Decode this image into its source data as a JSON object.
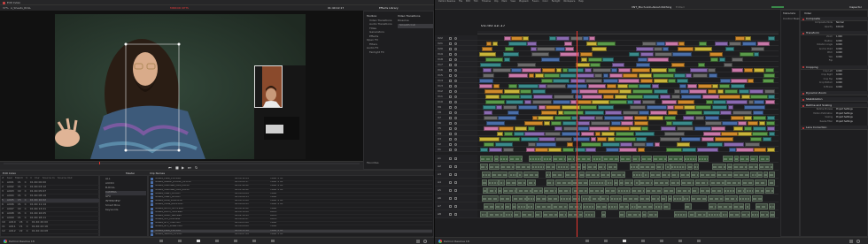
{
  "left_monitor": {
    "window_title": "Edit Index",
    "menu_items": [
      "File",
      "Edit",
      "Trim",
      "Timeline",
      "Clip",
      "Mark",
      "View",
      "Playback",
      "Fusion",
      "Color",
      "Fairlight",
      "Workspace",
      "Help"
    ],
    "viewer_title": "MIRROR OPTS",
    "viewer_zoom": "37%",
    "clip_name": "A_Sheets_ROLL",
    "timecode": "01:40:12:17",
    "effects_tab": "Effects Library",
    "toolbox": [
      "Toolbox",
      "Video Transitions",
      "Audio Transitions",
      "Titles",
      "Generators",
      "Effects",
      "Open FX",
      "Filters",
      "Audio FX",
      "Fairlight FX"
    ],
    "video_transitions_header": "Video Transitions",
    "transition_items": [
      "Dissolve",
      "Smooth Cut"
    ],
    "favorites": "Favorites",
    "edit_index_title": "Edit Index",
    "edit_index_columns": [
      "#",
      "Reel",
      "Match",
      "V",
      "C",
      "Dur",
      "Source In",
      "Source Out",
      "Record In",
      "Record Out",
      "Name"
    ],
    "edit_index_rows": [
      [
        "1",
        "A001",
        "V1",
        "C",
        "01:40:00:00"
      ],
      [
        "2",
        "A002",
        "V1",
        "C",
        "01:40:03:12"
      ],
      [
        "3",
        "A003",
        "V2",
        "C",
        "01:40:05:07"
      ],
      [
        "4",
        "A004",
        "V1",
        "C",
        "01:40:08:19"
      ],
      [
        "5",
        "A005",
        "V3",
        "C",
        "01:40:10:02"
      ],
      [
        "6",
        "A006",
        "V1",
        "C",
        "01:40:11:14"
      ],
      [
        "7",
        "A007",
        "V2",
        "C",
        "01:40:13:21"
      ],
      [
        "8",
        "A008",
        "V1",
        "C",
        "01:40:16:05"
      ],
      [
        "9",
        "A009",
        "V1",
        "C",
        "01:40:18:11"
      ],
      [
        "10",
        "A010",
        "V4",
        "C",
        "01:40:20:00"
      ],
      [
        "11",
        "A011",
        "V1",
        "C",
        "01:40:22:16"
      ],
      [
        "12",
        "A012",
        "V2",
        "C",
        "01:40:24:08"
      ]
    ],
    "bin_title": "Master",
    "bins": [
      "ALL",
      "AUDIO",
      "B-ROLL",
      "CAMERA",
      "GFX",
      "INTERVIEW",
      "Smart Bins",
      "Keywords"
    ],
    "clip_list_title": "Clip Names",
    "clip_rows": [
      [
        "Sheets_Plate_V01.R3D",
        "00:00:12:04",
        "Video + A1"
      ],
      [
        "Sheets_Master_B-ROLL_01.R3D",
        "00:00:08:17",
        "Video + A1"
      ],
      [
        "Sheets_Interview_CAM_A.R3D",
        "00:01:40:22",
        "Video + A1"
      ],
      [
        "Sheets_Interview_CAM_B.R3D",
        "00:01:40:22",
        "Video + A1"
      ],
      [
        "Sheets_Insert_01.R3D",
        "00:00:04:09",
        "Video"
      ],
      [
        "Sheets_Insert_02.R3D",
        "00:00:06:13",
        "Video"
      ],
      [
        "Sheets_Wide_ROLL.R3D",
        "00:00:15:00",
        "Video + A1"
      ],
      [
        "Sheets_Close_ROLL.R3D",
        "00:00:09:21",
        "Video + A1"
      ],
      [
        "Sheets_Mirror_OPTS.R3D",
        "00:00:11:02",
        "Video"
      ],
      [
        "Sheets_Room_Tone.wav",
        "00:00:30:00",
        "Audio"
      ],
      [
        "Sheets_Music_Bed.wav",
        "00:02:14:11",
        "Audio"
      ],
      [
        "Sheets_SFX_Door.wav",
        "00:00:02:07",
        "Audio"
      ],
      [
        "Sheets_GFX_Title.mov",
        "00:00:05:00",
        "Video"
      ],
      [
        "Sheets_GFX_Lower.mov",
        "00:00:04:00",
        "Video"
      ],
      [
        "Sheets_Plate_V02.R3D",
        "00:00:13:18",
        "Video + A1"
      ],
      [
        "Sheets_Selects_01.R3D",
        "00:00:07:09",
        "Video + A1"
      ]
    ],
    "app_name": "DaVinci Resolve 18"
  },
  "right_monitor": {
    "menu_items": [
      "DaVinci Resolve",
      "File",
      "Edit",
      "Trim",
      "Timeline",
      "Clip",
      "Mark",
      "View",
      "Playback",
      "Fusion",
      "Color",
      "Fairlight",
      "Workspace",
      "Help"
    ],
    "project_title": "VNT_Much-Ado-About-Nothing",
    "project_status": "Edited",
    "timecode": "01:40:12:17",
    "video_tracks": [
      "V22",
      "V21",
      "V20",
      "V19",
      "V18",
      "V17",
      "V16",
      "V15",
      "V14",
      "V13",
      "V12",
      "V11",
      "V10",
      "V9",
      "V8",
      "V7",
      "V6",
      "V5",
      "V4",
      "V3",
      "V2",
      "V1"
    ],
    "audio_tracks": [
      "A1",
      "A2",
      "A3",
      "A4",
      "A5",
      "A6",
      "A7",
      "A8"
    ],
    "inspector_tab": "Inspector",
    "inspector_sub": "Video",
    "inspector_sections": [
      {
        "label": "Composite",
        "fields": [
          [
            "Composite Mode",
            "Normal"
          ],
          [
            "Opacity",
            "100.00"
          ]
        ]
      },
      {
        "label": "Transform",
        "fields": [
          [
            "Zoom",
            "1.000"
          ],
          [
            "Position",
            "0.000"
          ],
          [
            "Rotation Angle",
            "0.000"
          ],
          [
            "Anchor Point",
            "0.000"
          ],
          [
            "Pitch",
            "0.000"
          ],
          [
            "Yaw",
            "0.000"
          ],
          [
            "Flip",
            ""
          ]
        ]
      },
      {
        "label": "Cropping",
        "fields": [
          [
            "Crop Left",
            "0.000"
          ],
          [
            "Crop Right",
            "0.000"
          ],
          [
            "Crop Top",
            "0.000"
          ],
          [
            "Crop Bottom",
            "0.000"
          ],
          [
            "Softness",
            "0.000"
          ]
        ]
      },
      {
        "label": "Dynamic Zoom",
        "fields": []
      },
      {
        "label": "Stabilization",
        "fields": []
      },
      {
        "label": "Retime and Scaling",
        "fields": [
          [
            "Retime Process",
            "Project Settings"
          ],
          [
            "Motion Estimation",
            "Project Settings"
          ],
          [
            "Scaling",
            "Project Settings"
          ],
          [
            "Resize Filter",
            "Project Settings"
          ]
        ]
      },
      {
        "label": "Lens Correction",
        "fields": []
      }
    ],
    "side_panel_title": "Metadata",
    "side_panel_item": "Control Basic",
    "app_name": "DaVinci Resolve 18"
  },
  "colors": {
    "clip_blue": "#4a6ea8",
    "clip_pink": "#c978a8",
    "clip_orange": "#d08a2c",
    "clip_yellow": "#c9b43a",
    "clip_green": "#5a9a4a",
    "clip_teal": "#3a8a8a",
    "clip_gray": "#6a6a6a",
    "clip_purple": "#8a6ab0",
    "playhead": "#e8352e",
    "accent_red": "#e03a3a"
  }
}
